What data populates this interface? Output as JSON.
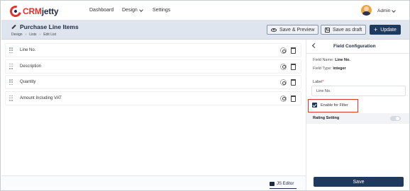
{
  "app": {
    "logo_crm": "CRM",
    "logo_jetty": "jetty"
  },
  "nav": {
    "items": [
      {
        "label": "Dashboard"
      },
      {
        "label": "Design"
      },
      {
        "label": "Settings"
      }
    ],
    "user": "Admin"
  },
  "page": {
    "title": "Purchase Line Items",
    "breadcrumb": [
      "Design",
      "Lists",
      "Edit List"
    ],
    "actions": {
      "save_preview": "Save & Preview",
      "save_draft": "Save as draft",
      "update": "Update"
    }
  },
  "fields": [
    {
      "label": "Line No."
    },
    {
      "label": "Description"
    },
    {
      "label": "Quantity"
    },
    {
      "label": "Amount Including VAT"
    }
  ],
  "footer": {
    "js_editor": "JS Editor"
  },
  "panel": {
    "title": "Field Configuration",
    "field_name_label": "Field Name:",
    "field_name": "Line No.",
    "field_type_label": "Field Type:",
    "field_type": "integer",
    "label_label": "Label",
    "label_required": "*",
    "label_value": "Line No.",
    "enable_filter_label": "Enable for Filter",
    "enable_filter_checked": true,
    "rating_label": "Rating Setting",
    "rating_enabled": false,
    "save_label": "Save"
  },
  "colors": {
    "brand_red": "#e2332b",
    "primary_navy": "#1f3a5f",
    "header_bg": "#dfe5ef"
  }
}
